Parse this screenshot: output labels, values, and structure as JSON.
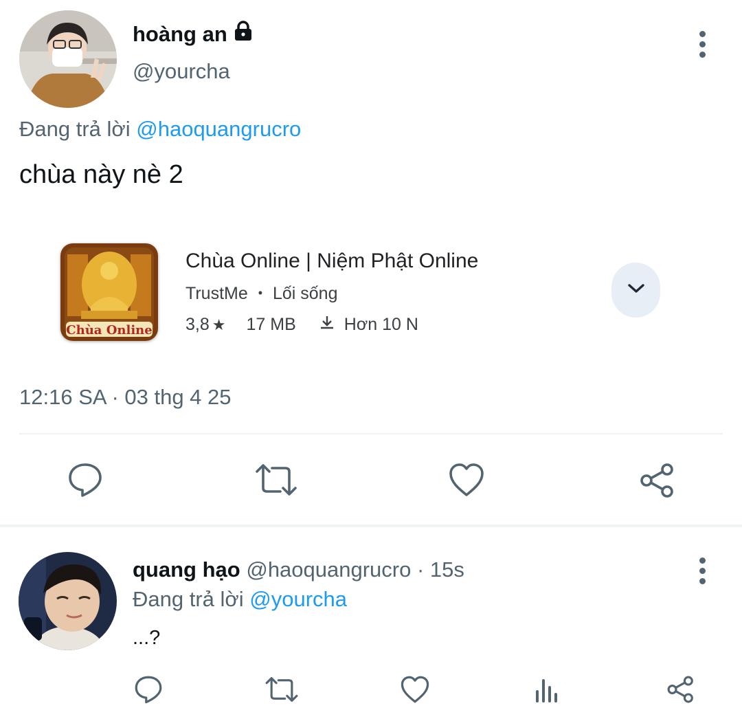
{
  "main_tweet": {
    "display_name": "hoàng an",
    "handle": "@yourcha",
    "reply_prefix": "Đang trả lời",
    "reply_to": "@haoquangrucro",
    "text": "chùa này nè 2",
    "timestamp": "12:16 SA · 03 thg 4 25",
    "app_card": {
      "title": "Chùa Online | Niệm Phật Online",
      "developer": "TrustMe",
      "separator": "•",
      "category": "Lối sống",
      "rating": "3,8",
      "star": "★",
      "size": "17 MB",
      "downloads": "Hơn 10 N",
      "icon_text": "Chùa Online"
    },
    "actions": [
      "reply-icon",
      "retweet-icon",
      "like-icon",
      "share-icon"
    ]
  },
  "reply_tweet": {
    "display_name": "quang hạo",
    "meta": "@haoquangrucro · 15s",
    "reply_prefix": "Đang trả lời",
    "reply_to": "@yourcha",
    "text": "...?",
    "actions": [
      "reply-icon",
      "retweet-icon",
      "like-icon",
      "views-icon",
      "share-icon"
    ]
  },
  "colors": {
    "link": "#1d9bf0",
    "muted": "#536471",
    "text": "#0f1419",
    "divider": "#eff3f4",
    "chip": "#e8eef5"
  }
}
